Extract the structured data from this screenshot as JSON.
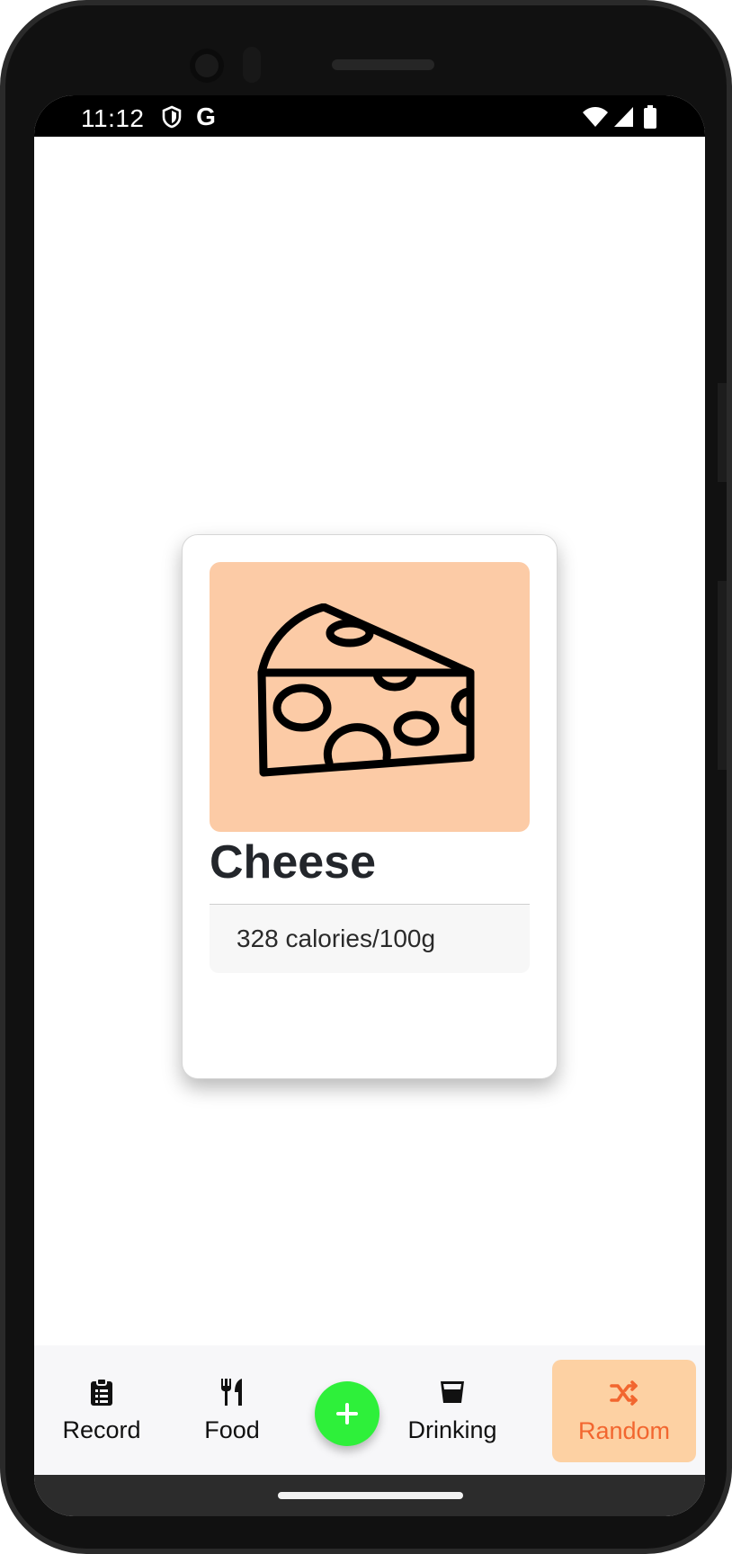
{
  "status_bar": {
    "time": "11:12",
    "icons": [
      "shield-icon",
      "google-g-icon",
      "wifi-icon",
      "signal-icon",
      "battery-icon"
    ],
    "google_glyph": "G"
  },
  "card": {
    "title": "Cheese",
    "calories": "328 calories/100g",
    "image_icon": "cheese-icon",
    "image_bg_color": "#fccba6"
  },
  "bottom_nav": {
    "items": [
      {
        "label": "Record",
        "icon": "clipboard-list-icon",
        "active": false
      },
      {
        "label": "Food",
        "icon": "fork-knife-icon",
        "active": false
      },
      {
        "label": "Drinking",
        "icon": "cup-icon",
        "active": false
      },
      {
        "label": "Random",
        "icon": "shuffle-icon",
        "active": true
      }
    ],
    "fab_icon": "plus-icon",
    "fab_color": "#2ef03a",
    "active_bg_color": "#fdd1a3",
    "active_text_color": "#f2662f"
  }
}
